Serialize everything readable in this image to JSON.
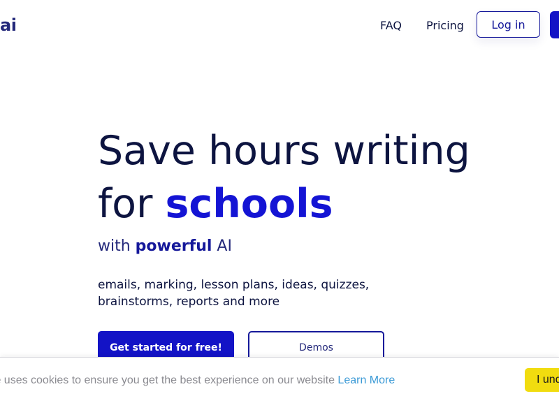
{
  "header": {
    "logo_text": "ai",
    "nav": [
      {
        "label": "FAQ"
      },
      {
        "label": "Pricing"
      }
    ],
    "login_label": "Log in"
  },
  "hero": {
    "title_line1": "Save hours writing",
    "title_line2_prefix": "for ",
    "title_line2_accent": "schools",
    "subtitle_prefix": "with ",
    "subtitle_bold": "powerful",
    "subtitle_suffix": " AI",
    "description": "emails, marking, lesson plans, ideas, quizzes, brainstorms, reports and more",
    "cta_primary": "Get started for free!",
    "cta_secondary": "Demos"
  },
  "cookie": {
    "text": "te uses cookies to ensure you get the best experience on our website ",
    "link_text": "Learn More",
    "accept_label": "I und"
  },
  "colors": {
    "brand_blue": "#1313c6",
    "navy_text": "#0d1440",
    "cookie_button": "#f1dc0f",
    "link_blue": "#3b9ad6"
  }
}
